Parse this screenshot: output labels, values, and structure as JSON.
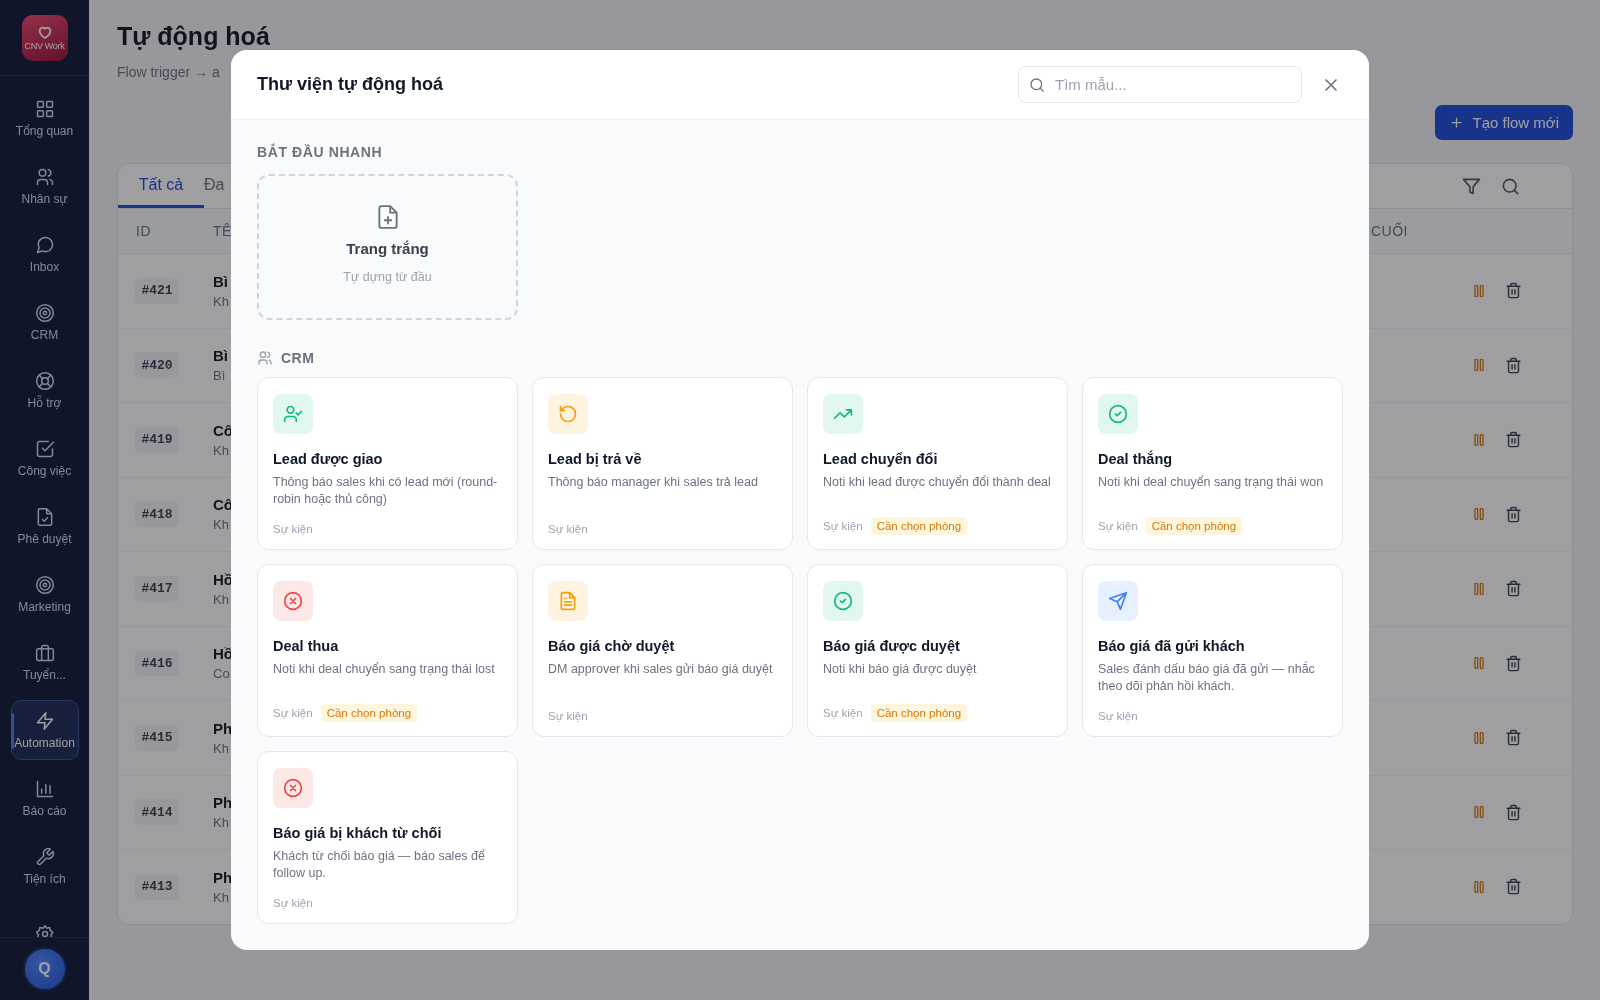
{
  "sidebar": {
    "logo_text": "CNV Work",
    "items": [
      {
        "kind": "overview",
        "label": "Tổng quan",
        "selected": false
      },
      {
        "kind": "people",
        "label": "Nhân sự",
        "selected": false
      },
      {
        "kind": "inbox",
        "label": "Inbox",
        "selected": false
      },
      {
        "kind": "target",
        "label": "CRM",
        "selected": false
      },
      {
        "kind": "support",
        "label": "Hỗ trợ",
        "selected": false
      },
      {
        "kind": "tasks",
        "label": "Công việc",
        "selected": false
      },
      {
        "kind": "approval",
        "label": "Phê duyệt",
        "selected": false
      },
      {
        "kind": "target",
        "label": "Marketing",
        "selected": false
      },
      {
        "kind": "recruit",
        "label": "Tuyển...",
        "selected": false
      },
      {
        "kind": "automation",
        "label": "Automation",
        "selected": true
      },
      {
        "kind": "reports",
        "label": "Báo cáo",
        "selected": false
      },
      {
        "kind": "tools",
        "label": "Tiện ích",
        "selected": false
      },
      {
        "kind": "settings",
        "selected": false
      }
    ],
    "avatar": "Q"
  },
  "page": {
    "title": "Tự động hoá",
    "subtitle": "Flow trigger → a",
    "new_button": "Tạo flow mới",
    "tabs": [
      {
        "label": "Tất cả",
        "selected": true
      },
      {
        "label": "Đa",
        "selected": false
      }
    ],
    "columns": [
      "ID",
      "TÊ",
      "CUỐI"
    ],
    "rows": [
      {
        "id": "#421",
        "name": "Bì",
        "sub": "Kh"
      },
      {
        "id": "#420",
        "name": "Bì",
        "sub": "Bì"
      },
      {
        "id": "#419",
        "name": "Cô",
        "sub": "Kh"
      },
      {
        "id": "#418",
        "name": "Cô",
        "sub": "Kh"
      },
      {
        "id": "#417",
        "name": "Hồ",
        "sub": "Kh"
      },
      {
        "id": "#416",
        "name": "Hồ",
        "sub": "Co"
      },
      {
        "id": "#415",
        "name": "Ph",
        "sub": "Kh"
      },
      {
        "id": "#414",
        "name": "Ph",
        "sub": "Kh"
      },
      {
        "id": "#413",
        "name": "Ph",
        "sub": "Kh"
      }
    ]
  },
  "modal": {
    "title": "Thư viện tự động hoá",
    "search": {
      "placeholder": "Tìm mẫu..."
    },
    "quick_start": {
      "heading": "BẮT ĐẦU NHANH",
      "blank": {
        "title": "Trang trắng",
        "subtitle": "Tự dựng từ đầu"
      }
    },
    "sections": [
      {
        "heading": "CRM",
        "cards": [
          {
            "kind": "assign",
            "color": "#10b981",
            "title": "Lead được giao",
            "description": "Thông báo sales khi có lead mới (round-robin hoặc thủ công)",
            "type": "Sự kiện"
          },
          {
            "kind": "return",
            "color": "#f59e0b",
            "title": "Lead bị trả về",
            "description": "Thông báo manager khi sales trả lead",
            "type": "Sự kiện"
          },
          {
            "kind": "convert",
            "color": "#10b981",
            "title": "Lead chuyển đổi",
            "description": "Noti khi lead được chuyển đổi thành deal",
            "type": "Sự kiện",
            "badge": "Cần chọn phòng"
          },
          {
            "kind": "approved",
            "color": "#10b981",
            "title": "Deal thắng",
            "description": "Noti khi deal chuyển sang trạng thái won",
            "type": "Sự kiện",
            "badge": "Cần chọn phòng"
          },
          {
            "kind": "rejected",
            "color": "#ef4444",
            "title": "Deal thua",
            "description": "Noti khi deal chuyển sang trạng thái lost",
            "type": "Sự kiện",
            "badge": "Cần chọn phòng"
          },
          {
            "kind": "document",
            "color": "#f59e0b",
            "title": "Báo giá chờ duyệt",
            "description": "DM approver khi sales gửi báo giá duyệt",
            "type": "Sự kiện"
          },
          {
            "kind": "approved",
            "color": "#10b981",
            "title": "Báo giá được duyệt",
            "description": "Noti khi báo giá được duyệt",
            "type": "Sự kiện",
            "badge": "Cần chọn phòng"
          },
          {
            "kind": "sent",
            "color": "#3b82f6",
            "title": "Báo giá đã gửi khách",
            "description": "Sales đánh dấu báo giá đã gửi — nhắc theo dõi phản hồi khách.",
            "type": "Sự kiện"
          },
          {
            "kind": "rejected",
            "color": "#ef4444",
            "title": "Báo giá bị khách từ chối",
            "description": "Khách từ chối báo giá — báo sales để follow up.",
            "type": "Sự kiện"
          }
        ]
      }
    ]
  }
}
